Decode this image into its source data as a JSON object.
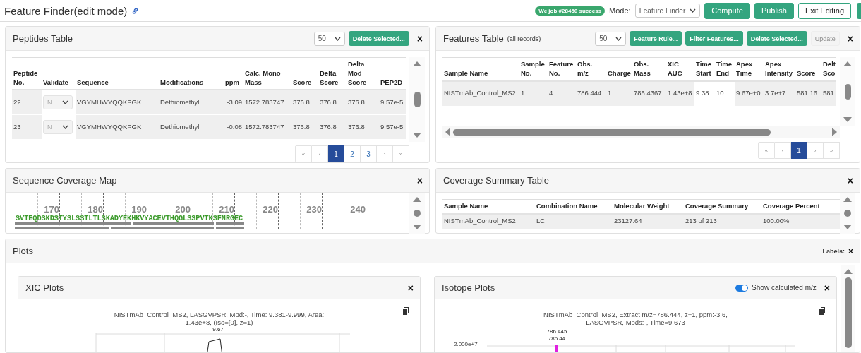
{
  "header": {
    "title": "Feature Finder(edit mode)",
    "job_badge": "We job #28456 success",
    "mode_label": "Mode:",
    "mode_select": "Feature Finder",
    "buttons": [
      {
        "label": "Compute",
        "kind": "primary"
      },
      {
        "label": "Publish",
        "kind": "primary"
      },
      {
        "label": "Exit Editing",
        "kind": "outline"
      }
    ]
  },
  "peptides_table": {
    "title": "Peptides Table",
    "page_size": "50",
    "close": "×",
    "actions": [
      {
        "label": "Delete Selected...",
        "disabled": false
      }
    ],
    "columns": [
      "Peptide No.",
      "Validate",
      "Sequence",
      "Modifications",
      "ppm",
      "Calc. Mono Mass",
      "Score",
      "Delta Score",
      "Delta Mod Score",
      "PEP2D"
    ],
    "rows": [
      {
        "cells": [
          "22",
          "N",
          "VGYMHWYQQKPGK",
          "Dethiomethyl",
          "-3.09",
          "1572.783747",
          "376.8",
          "376.8",
          "376.8",
          "9.57e-5"
        ]
      },
      {
        "cells": [
          "23",
          "N",
          "VGYMHWYQQKPGK",
          "Dethiomethyl",
          "-0.08",
          "1572.783747",
          "376.8",
          "376.8",
          "376.8",
          "9.57e-5"
        ]
      }
    ],
    "pagination": [
      {
        "label": "«",
        "selected": false
      },
      {
        "label": "‹",
        "selected": false
      },
      {
        "label": "1",
        "selected": true
      },
      {
        "label": "2",
        "selected": false
      },
      {
        "label": "3",
        "selected": false
      },
      {
        "label": "›",
        "selected": false
      },
      {
        "label": "»",
        "selected": false
      }
    ]
  },
  "features_table": {
    "title": "Features Table",
    "subtitle": "(all records)",
    "page_size": "50",
    "close": "×",
    "actions": [
      {
        "label": "Feature Rule...",
        "disabled": false
      },
      {
        "label": "Filter Features...",
        "disabled": false
      },
      {
        "label": "Delete Selected...",
        "disabled": false
      },
      {
        "label": "Update",
        "disabled": true
      }
    ],
    "columns": [
      "Sample Name",
      "Sample No.",
      "Feature No.",
      "Obs. m/z",
      "Charge",
      "Obs. Mass",
      "XIC AUC",
      "Time Start",
      "Time End",
      "Apex Time",
      "Apex Intensity",
      "Score",
      "Delt Sco"
    ],
    "rows": [
      {
        "cells": [
          "NISTmAb_Control_MS2",
          "1",
          "4",
          "786.444",
          "1",
          "785.4367",
          "1.43e+8",
          "9.38",
          "10",
          "9.67e+0",
          "3.7e+7",
          "581.16",
          "581."
        ]
      }
    ],
    "pagination": [
      {
        "label": "«",
        "selected": false
      },
      {
        "label": "‹",
        "selected": false
      },
      {
        "label": "1",
        "selected": true
      },
      {
        "label": "›",
        "selected": false
      },
      {
        "label": "»",
        "selected": false
      }
    ]
  },
  "sequence_coverage_map": {
    "title": "Sequence Coverage Map",
    "close": "×",
    "ticks": [
      "170",
      "180",
      "190",
      "200",
      "210",
      "220",
      "230",
      "240"
    ],
    "sequence": "SVTEQDSKDSTYSLSSTLTLSKADYEKHKVYACEVTHQGLSSPVTKSFNRGEC"
  },
  "coverage_summary_table": {
    "title": "Coverage Summary Table",
    "close": "×",
    "columns": [
      "Sample Name",
      "Combination Name",
      "Molecular Weight",
      "Coverage Summary",
      "Coverage Percent"
    ],
    "rows": [
      {
        "cells": [
          "NISTmAb_Control_MS2",
          "LC",
          "23127.64",
          "213 of 213",
          "100.00%"
        ]
      }
    ]
  },
  "plots": {
    "title": "Plots",
    "labels_label": "Labels:",
    "close": "×",
    "panels": [
      {
        "kind": "xic",
        "title": "XIC Plots",
        "close": "×",
        "chart_title": "NISTmAb_Control_MS2, LASGVPSR, Mod:-, Time: 9.381-9.999, Area: 1.43e+8, (Iso=[0], z=1)",
        "peak_labels": [
          "9.67"
        ]
      },
      {
        "kind": "isotope",
        "title": "Isotope Plots",
        "close": "×",
        "toggle": {
          "label": "Show calculated m/z",
          "on": true
        },
        "chart_title": "NISTmAb_Control_MS2, Extract m/z=786.444, z=1, ppm:-3.6, LASGVPSR, Mods:-, Time=9.673",
        "y_tick": "2.000e+7",
        "peak_labels": [
          "786.445",
          "786.44"
        ]
      }
    ]
  }
}
